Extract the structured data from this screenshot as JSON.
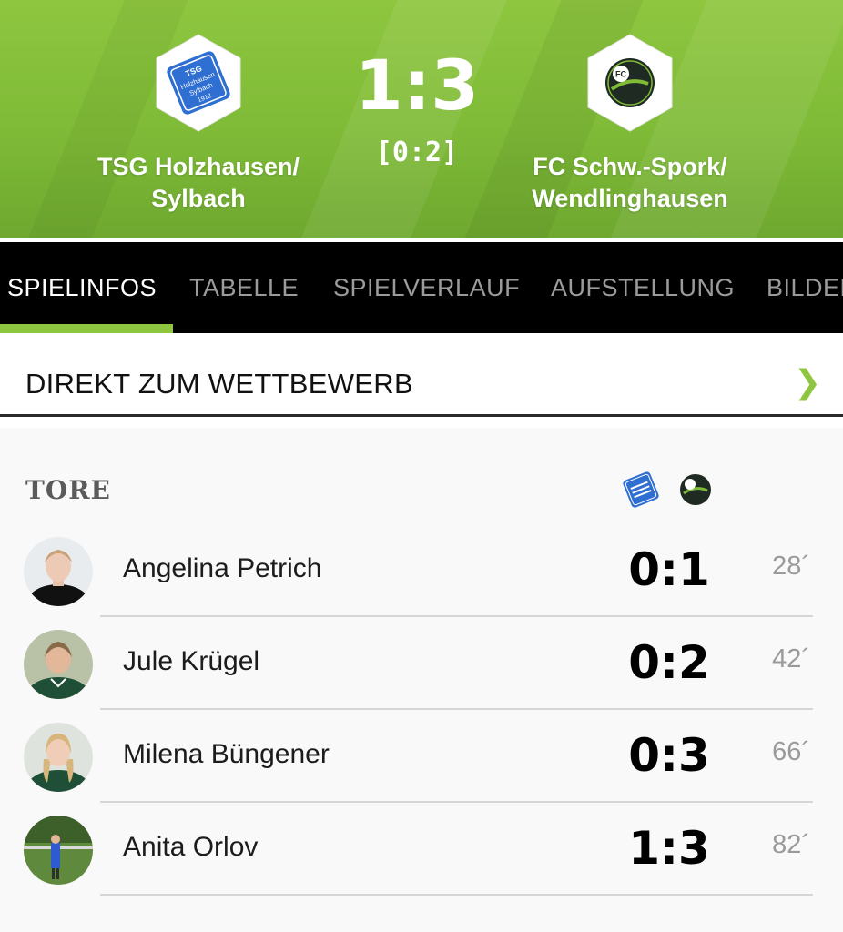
{
  "match": {
    "home": {
      "name_line1": "TSG Holzhausen/",
      "name_line2": "Sylbach",
      "crest_icon": "tsg-holzhausen-crest",
      "crest_text": [
        "TSG",
        "Holzhausen",
        "Sylbach",
        "1912"
      ]
    },
    "away": {
      "name_line1": "FC Schw.-Spork/",
      "name_line2": "Wendlinghausen",
      "crest_icon": "fc-schwelentrup-crest",
      "crest_text": [
        "FC"
      ]
    },
    "score": "1:3",
    "halftime": "[0:2]"
  },
  "tabs": [
    {
      "label": "SPIELINFOS",
      "active": true
    },
    {
      "label": "TABELLE",
      "active": false
    },
    {
      "label": "SPIELVERLAUF",
      "active": false
    },
    {
      "label": "AUFSTELLUNG",
      "active": false
    },
    {
      "label": "BILDER",
      "active": false
    }
  ],
  "competition_link": {
    "label": "DIREKT ZUM WETTBEWERB",
    "chevron_icon": "chevron-right-icon"
  },
  "goals": {
    "title": "TORE",
    "rows": [
      {
        "player": "Angelina Petrich",
        "score": "0:1",
        "minute": "28´"
      },
      {
        "player": "Jule Krügel",
        "score": "0:2",
        "minute": "42´"
      },
      {
        "player": "Milena Büngener",
        "score": "0:3",
        "minute": "66´"
      },
      {
        "player": "Anita Orlov",
        "score": "1:3",
        "minute": "82´"
      }
    ]
  },
  "colors": {
    "accent_green": "#8ec63f",
    "home_blue": "#2f6fd1",
    "away_dark": "#1f2a22"
  }
}
